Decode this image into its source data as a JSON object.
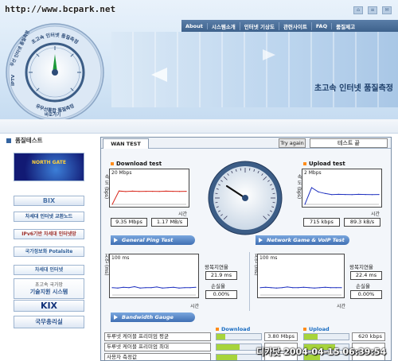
{
  "watermark": "http://www.bcpark.net",
  "header": {
    "nav": [
      "About",
      "시스템소개",
      "인터넷 기상도",
      "관련사이트",
      "FAQ",
      "품질제고"
    ],
    "hero_title": "초고속 인터넷 품질측정",
    "dial_labels": [
      "초고속 인터넷 품질측정",
      "무선 인터넷 품질측정",
      "IPTV",
      "바로가기",
      "유무선통합 품질측정"
    ]
  },
  "sidebar": {
    "title": "품질테스트",
    "banners": {
      "north": "NORTH GATE",
      "bix": "BIX",
      "b1": "차세대 인터넷 교환노드",
      "b2": "IPv6기반 차세대 인터넷망",
      "b3": "국가정보화 Potalsite",
      "b4": "차세대 인터넷",
      "tech1": "초고속 국가망",
      "tech2": "기술지원 시스템",
      "kix": "KIX",
      "gov": "국무총리실"
    }
  },
  "panel": {
    "tab": "WAN TEST",
    "try_again": "Try again",
    "status": "테스트 끝",
    "download": {
      "title": "Download test",
      "scale": "20 Mbps",
      "unit": "속 도 (bps)",
      "time_label": "시간",
      "mbps": "9.35 Mbps",
      "mbs": "1.17 MB/s"
    },
    "upload": {
      "title": "Upload test",
      "scale": "2 Mbps",
      "unit": "속 도 (bps)",
      "time_label": "시간",
      "kbps": "715 kbps",
      "kbs": "89.3 kB/s"
    },
    "ping_bar": "General Ping Test",
    "game_bar": "Network Game & VoIP Test",
    "ping": {
      "scale": "100 ms",
      "unit": "지연 (ms)",
      "time_label": "시간",
      "rtt_label": "왕복지연율",
      "rtt": "21.9 ms",
      "loss_label": "손실율",
      "loss": "0.00%"
    },
    "game": {
      "scale": "100 ms",
      "unit": "지연 (ms)",
      "time_label": "시간",
      "rtt_label": "왕복지연율",
      "rtt": "22.4 ms",
      "loss_label": "손실율",
      "loss": "0.00%"
    },
    "bw_bar": "Bandwidth Gauge",
    "bw_download": "Download",
    "bw_upload": "Upload",
    "bw_rows": [
      {
        "name": "두루넷 케이블 프리미엄 평균",
        "down": "3.80 Mbps",
        "down_frac": 0.19,
        "up": "620 kbps",
        "up_frac": 0.31
      },
      {
        "name": "두루넷 케이블 프리미엄 최대",
        "down": "",
        "down_frac": 0.52,
        "up": "",
        "up_frac": 0.7
      },
      {
        "name": "사용자 측정값",
        "down": "",
        "down_frac": 0.47,
        "up": "",
        "up_frac": 0.36
      }
    ]
  },
  "timestamp": "디카닷 2004-04-15 06:39:54",
  "colors": {
    "nav": "#3d618b",
    "section": "#3f6fb3",
    "fill": "#a7d43b",
    "series_red": "#d8261a",
    "series_blue": "#1d2fbf"
  },
  "chart_data": [
    {
      "type": "line",
      "title": "Download test",
      "ylabel": "속 도 (bps)",
      "xlabel": "시간",
      "ylim": [
        0,
        20
      ],
      "series": [
        {
          "values": [
            0,
            9.6,
            9.2,
            9.5,
            9.3,
            9.4,
            9.4,
            9.3,
            9.5,
            9.4,
            9.3,
            9.4
          ]
        }
      ]
    },
    {
      "type": "line",
      "title": "Upload test",
      "ylabel": "속 도 (bps)",
      "xlabel": "시간",
      "ylim": [
        0,
        2
      ],
      "series": [
        {
          "values": [
            0,
            1.2,
            0.9,
            0.78,
            0.7,
            0.72,
            0.71,
            0.7,
            0.72,
            0.71,
            0.7,
            0.71
          ]
        }
      ]
    },
    {
      "type": "line",
      "ylabel": "지연 (ms)",
      "xlabel": "시간",
      "ylim": [
        0,
        100
      ],
      "series": [
        {
          "values": [
            22,
            21,
            23,
            22,
            25,
            21,
            22,
            22,
            24,
            21,
            22,
            23,
            21,
            22,
            22,
            23
          ]
        }
      ]
    },
    {
      "type": "line",
      "ylabel": "지연 (ms)",
      "xlabel": "시간",
      "ylim": [
        0,
        100
      ],
      "series": [
        {
          "values": [
            22,
            23,
            22,
            21,
            22,
            24,
            22,
            22,
            23,
            22,
            21,
            22,
            23,
            22,
            22,
            22
          ]
        }
      ]
    }
  ]
}
